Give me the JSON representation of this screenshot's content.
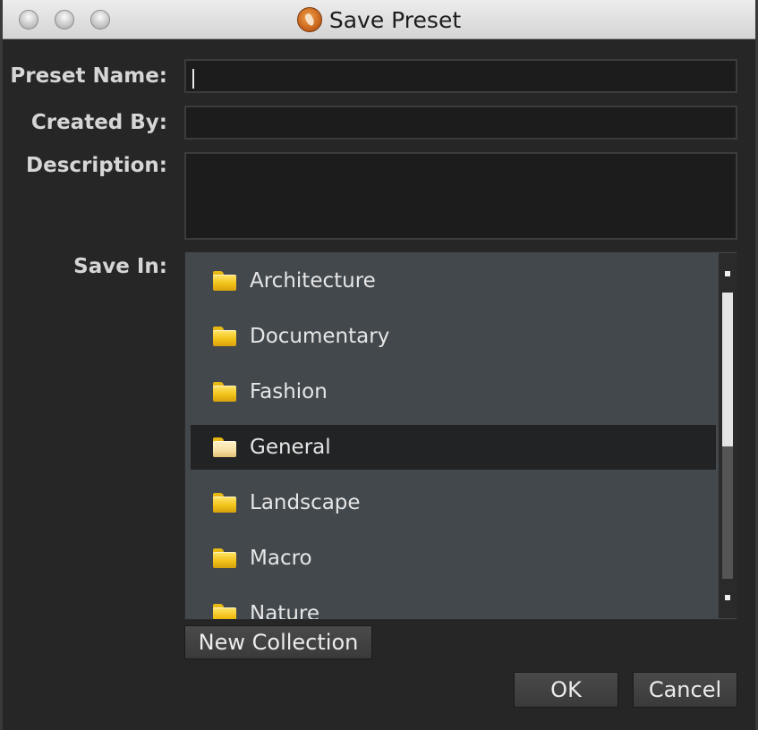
{
  "window": {
    "title": "Save Preset"
  },
  "form": {
    "preset_name_label": "Preset Name:",
    "preset_name_value": "",
    "created_by_label": "Created By:",
    "created_by_value": "",
    "description_label": "Description:",
    "description_value": "",
    "save_in_label": "Save In:"
  },
  "save_in": {
    "items": [
      {
        "label": "Architecture"
      },
      {
        "label": "Documentary"
      },
      {
        "label": "Fashion"
      },
      {
        "label": "General",
        "selected": true
      },
      {
        "label": "Landscape"
      },
      {
        "label": "Macro"
      },
      {
        "label": "Nature"
      }
    ]
  },
  "buttons": {
    "new_collection": "New Collection",
    "ok": "OK",
    "cancel": "Cancel"
  },
  "icons": {
    "folder": "folder-icon",
    "folder_open": "folder-open-icon",
    "app": "aperture-app-icon"
  }
}
